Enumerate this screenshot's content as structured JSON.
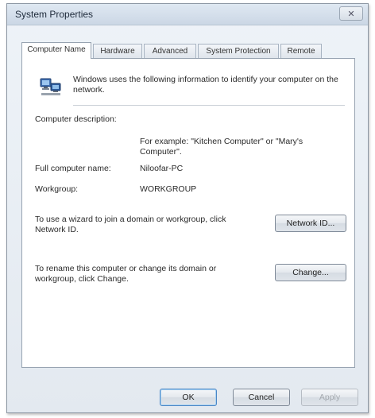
{
  "window": {
    "title": "System Properties",
    "close_glyph": "✕"
  },
  "tabs": [
    {
      "label": "Computer Name",
      "active": true
    },
    {
      "label": "Hardware",
      "active": false
    },
    {
      "label": "Advanced",
      "active": false
    },
    {
      "label": "System Protection",
      "active": false
    },
    {
      "label": "Remote",
      "active": false
    }
  ],
  "intro": {
    "icon": "computer-network-icon",
    "text": "Windows uses the following information to identify your computer on the network."
  },
  "computer_description": {
    "label": "Computer description:",
    "value": "",
    "hint": "For example: \"Kitchen Computer\" or \"Mary's Computer\"."
  },
  "full_name": {
    "label": "Full computer name:",
    "value": "Niloofar-PC"
  },
  "workgroup": {
    "label": "Workgroup:",
    "value": "WORKGROUP"
  },
  "network_id": {
    "text": "To use a wizard to join a domain or workgroup, click Network ID.",
    "button": "Network ID..."
  },
  "change": {
    "text": "To rename this computer or change its domain or workgroup, click Change.",
    "button": "Change..."
  },
  "footer": {
    "ok": "OK",
    "cancel": "Cancel",
    "apply": "Apply"
  },
  "colors": {
    "accent": "#4a86c6",
    "disabled_text": "#a3a8ae"
  }
}
